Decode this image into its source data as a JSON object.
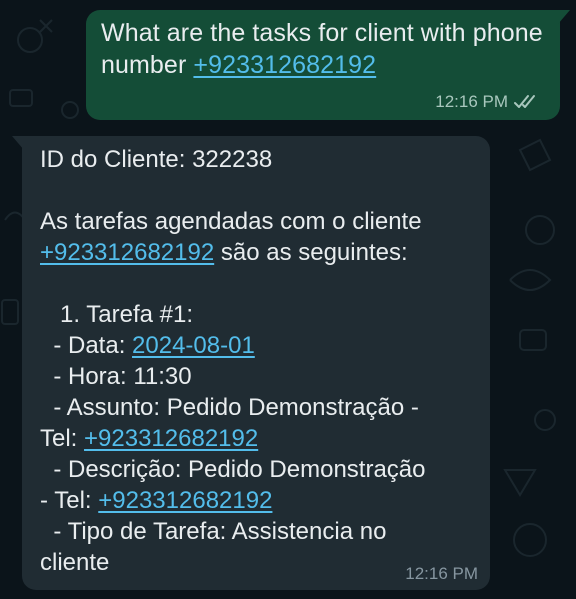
{
  "chat": {
    "outgoing": {
      "text": "What are the tasks for client with phone number ",
      "phone_link": "+923312682192",
      "time": "12:16 PM",
      "status_icon": "double-check-icon"
    },
    "incoming": {
      "client_id_line": "ID do Cliente: 322238",
      "intro_line1": "As tarefas agendadas com o cliente",
      "intro_phone": "+923312682192",
      "intro_line2_suffix": " são as seguintes:",
      "task_title": "   1. Tarefa #1:",
      "date_prefix": "  - Data: ",
      "date_link": "2024-08-01",
      "hour_line": "  - Hora: 11:30",
      "subject_line": "  - Assunto: Pedido Demonstração -",
      "subject_tel_prefix": "Tel: ",
      "subject_phone": "+923312682192",
      "description_line": "  - Descrição: Pedido Demonstração",
      "description_tel_prefix": "- Tel: ",
      "description_phone": "+923312682192",
      "task_type_line": "  - Tipo de Tarefa: Assistencia no",
      "task_type_cont": "cliente",
      "time": "12:16 PM"
    }
  },
  "colors": {
    "background": "#0b141a",
    "outgoing_bubble": "#144d37",
    "incoming_bubble": "#202c33",
    "link": "#53bdeb"
  }
}
